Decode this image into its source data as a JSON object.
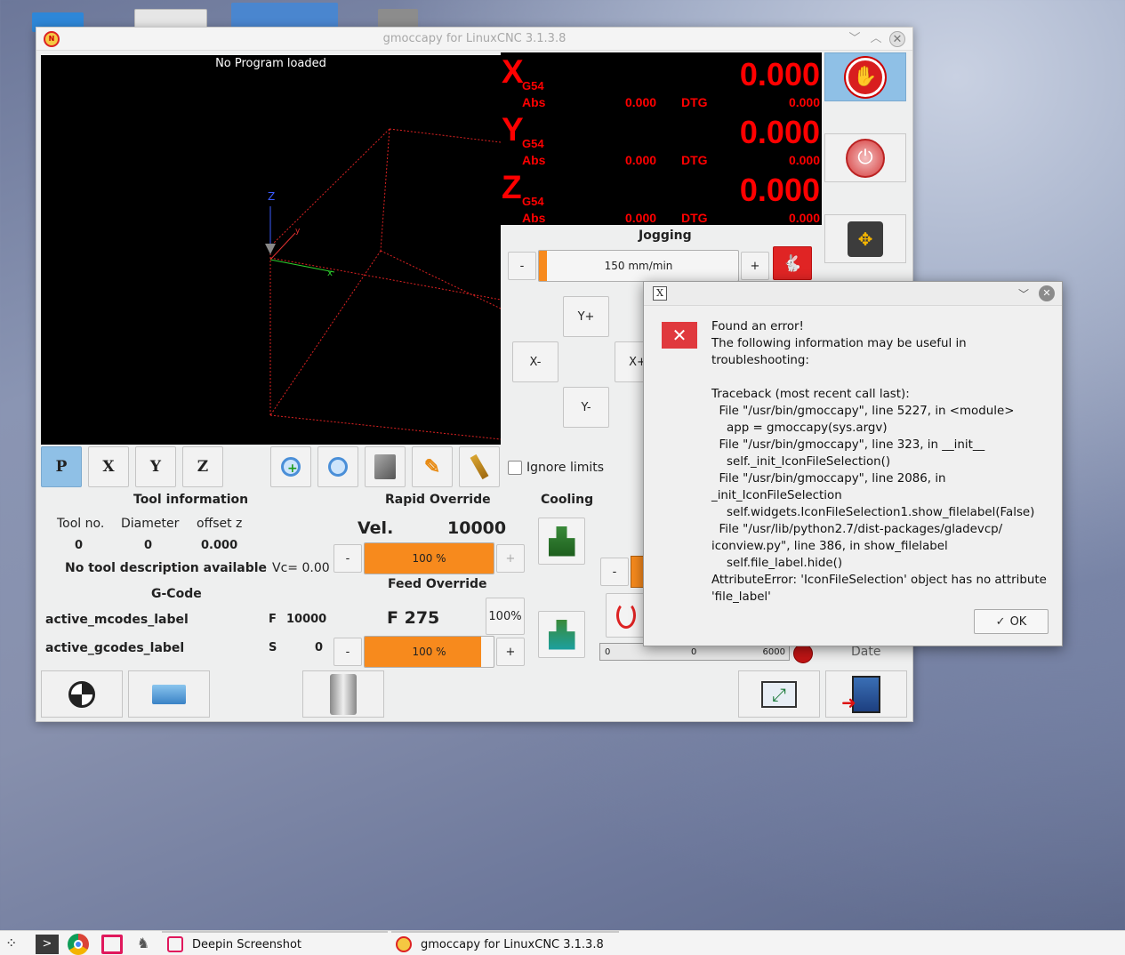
{
  "window": {
    "title": "gmoccapy for LinuxCNC 3.1.3.8"
  },
  "preview": {
    "message": "No Program loaded",
    "axis_label": "Z"
  },
  "view_buttons": [
    "P",
    "X",
    "Y",
    "Z"
  ],
  "dro": {
    "axes": [
      {
        "letter": "X",
        "system": "G54",
        "value": "0.000",
        "abs_label": "Abs",
        "abs_value": "0.000",
        "dtg_label": "DTG",
        "dtg_value": "0.000"
      },
      {
        "letter": "Y",
        "system": "G54",
        "value": "0.000",
        "abs_label": "Abs",
        "abs_value": "0.000",
        "dtg_label": "DTG",
        "dtg_value": "0.000"
      },
      {
        "letter": "Z",
        "system": "G54",
        "value": "0.000",
        "abs_label": "Abs",
        "abs_value": "0.000",
        "dtg_label": "DTG",
        "dtg_value": "0.000"
      }
    ]
  },
  "jogging": {
    "title": "Jogging",
    "minus": "-",
    "plus": "+",
    "speed": "150 mm/min",
    "speed_fraction": 0.04,
    "y_plus": "Y+",
    "y_minus": "Y-",
    "x_minus": "X-",
    "x_plus": "X+"
  },
  "ignore_limits": "Ignore limits",
  "tool_info": {
    "title": "Tool information",
    "h_tool": "Tool no.",
    "h_diam": "Diameter",
    "h_offset": "offset z",
    "v_tool": "0",
    "v_diam": "0",
    "v_offset": "0.000",
    "desc": "No tool description available",
    "vc": "Vc= 0.00"
  },
  "gcode": {
    "title": "G-Code",
    "mcodes": "active_mcodes_label",
    "gcodes": "active_gcodes_label",
    "f_label": "F",
    "f_value": "10000",
    "s_label": "S",
    "s_value": "0"
  },
  "rapid": {
    "title": "Rapid Override",
    "vel_label": "Vel.",
    "vel_value": "10000",
    "minus": "-",
    "plus": "+",
    "percent": "100 %",
    "fraction": 1.0
  },
  "feed": {
    "title": "Feed Override",
    "f_text": "F 275",
    "reset": "100%",
    "minus": "-",
    "plus": "+",
    "percent": "100 %",
    "fraction": 0.9
  },
  "cooling": {
    "title": "Cooling"
  },
  "spindle": {
    "minus": "-",
    "scale_min": "0",
    "scale_mid": "0",
    "scale_max": "6000",
    "date": "Date"
  },
  "dialog": {
    "heading": "Found an error!",
    "text": "The following information may be useful in troubleshooting:\n\nTraceback (most recent call last):\n  File \"/usr/bin/gmoccapy\", line 5227, in <module>\n    app = gmoccapy(sys.argv)\n  File \"/usr/bin/gmoccapy\", line 323, in __init__\n    self._init_IconFileSelection()\n  File \"/usr/bin/gmoccapy\", line 2086, in _init_IconFileSelection\n    self.widgets.IconFileSelection1.show_filelabel(False)\n  File \"/usr/lib/python2.7/dist-packages/gladevcp/\niconview.py\", line 386, in show_filelabel\n    self.file_label.hide()\nAttributeError: 'IconFileSelection' object has no attribute\n'file_label'",
    "ok": "OK",
    "check": "✓"
  },
  "taskbar": {
    "items": [
      "Deepin Screenshot",
      "gmoccapy for LinuxCNC  3.1.3.8"
    ]
  },
  "colors": {
    "dro_red": "#ff0000",
    "override_orange": "#f78a1d",
    "active_view": "#8fc0e6"
  }
}
